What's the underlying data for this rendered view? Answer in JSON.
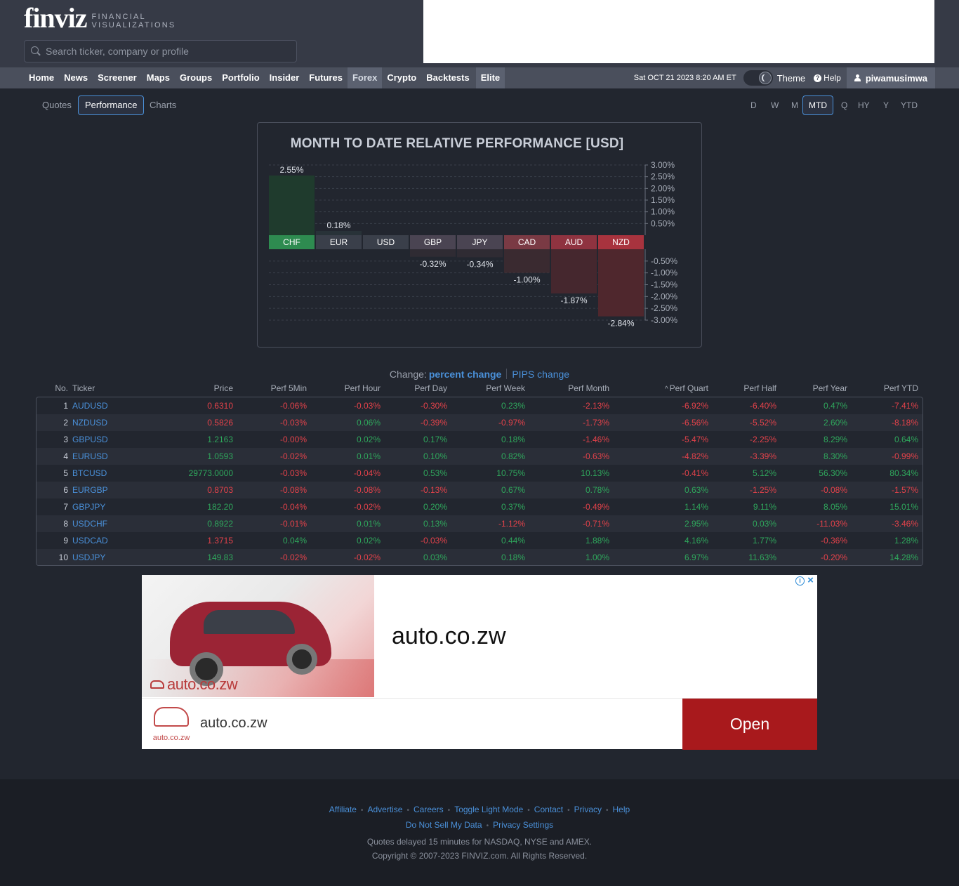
{
  "header": {
    "logo_word": "finviz",
    "logo_tag_line1": "FINANCIAL",
    "logo_tag_line2": "VISUALIZATIONS",
    "search_placeholder": "Search ticker, company or profile"
  },
  "nav": {
    "items": [
      {
        "label": "Home"
      },
      {
        "label": "News"
      },
      {
        "label": "Screener"
      },
      {
        "label": "Maps"
      },
      {
        "label": "Groups"
      },
      {
        "label": "Portfolio"
      },
      {
        "label": "Insider"
      },
      {
        "label": "Futures"
      },
      {
        "label": "Forex"
      },
      {
        "label": "Crypto"
      },
      {
        "label": "Backtests"
      },
      {
        "label": "Elite"
      }
    ],
    "active": "Forex",
    "datetime": "Sat OCT 21 2023 8:20 AM ET",
    "theme_label": "Theme",
    "help_label": "Help",
    "username": "piwamusimwa"
  },
  "view_tabs": [
    {
      "label": "Quotes"
    },
    {
      "label": "Performance"
    },
    {
      "label": "Charts"
    }
  ],
  "active_view": "Performance",
  "periods": [
    {
      "label": "D"
    },
    {
      "label": "W"
    },
    {
      "label": "M"
    },
    {
      "label": "MTD"
    },
    {
      "label": "Q"
    },
    {
      "label": "HY"
    },
    {
      "label": "Y"
    },
    {
      "label": "YTD"
    }
  ],
  "active_period": "MTD",
  "chart_data": {
    "type": "bar",
    "title": "MONTH TO DATE RELATIVE PERFORMANCE  [USD]",
    "categories": [
      "CHF",
      "EUR",
      "USD",
      "GBP",
      "JPY",
      "CAD",
      "AUD",
      "NZD"
    ],
    "values": [
      2.55,
      0.18,
      0.0,
      -0.32,
      -0.34,
      -1.0,
      -1.87,
      -2.84
    ],
    "value_labels": [
      "2.55%",
      "0.18%",
      "",
      "-0.32%",
      "-0.34%",
      "-1.00%",
      "-1.87%",
      "-2.84%"
    ],
    "yticks_pos": [
      "3.00%",
      "2.50%",
      "2.00%",
      "1.50%",
      "1.00%",
      "0.50%"
    ],
    "yticks_neg": [
      "-0.50%",
      "-1.00%",
      "-1.50%",
      "-2.00%",
      "-2.50%",
      "-3.00%"
    ],
    "ylim": [
      -3.0,
      3.0
    ],
    "label_colors": [
      "#2e8b50",
      "#3a3f4a",
      "#3a3f4a",
      "#4a4452",
      "#4a4452",
      "#7a3a44",
      "#8f3340",
      "#a8333e"
    ],
    "bar_colors": [
      "#1f3b2d",
      "#283238",
      "#262a33",
      "#2f2b33",
      "#2f2b33",
      "#3a2a30",
      "#45272e",
      "#4f272d"
    ],
    "grid": true
  },
  "change_selector": {
    "label": "Change:",
    "active": "percent change",
    "other": "PIPS change"
  },
  "table": {
    "columns": [
      "No.",
      "Ticker",
      "Price",
      "Perf 5Min",
      "Perf Hour",
      "Perf Day",
      "Perf Week",
      "Perf Month",
      "Perf Quart",
      "Perf Half",
      "Perf Year",
      "Perf YTD"
    ],
    "sort_column": "Perf Quart",
    "rows": [
      {
        "no": "1",
        "ticker": "AUDUSD",
        "price": "0.6310",
        "p5": "-0.06%",
        "ph": "-0.03%",
        "pd": "-0.30%",
        "pw": "0.23%",
        "pm": "-2.13%",
        "pq": "-6.92%",
        "phy": "-6.40%",
        "py": "0.47%",
        "pytd": "-7.41%"
      },
      {
        "no": "2",
        "ticker": "NZDUSD",
        "price": "0.5826",
        "p5": "-0.03%",
        "ph": "0.06%",
        "pd": "-0.39%",
        "pw": "-0.97%",
        "pm": "-1.73%",
        "pq": "-6.56%",
        "phy": "-5.52%",
        "py": "2.60%",
        "pytd": "-8.18%"
      },
      {
        "no": "3",
        "ticker": "GBPUSD",
        "price": "1.2163",
        "p5": "-0.00%",
        "ph": "0.02%",
        "pd": "0.17%",
        "pw": "0.18%",
        "pm": "-1.46%",
        "pq": "-5.47%",
        "phy": "-2.25%",
        "py": "8.29%",
        "pytd": "0.64%"
      },
      {
        "no": "4",
        "ticker": "EURUSD",
        "price": "1.0593",
        "p5": "-0.02%",
        "ph": "0.01%",
        "pd": "0.10%",
        "pw": "0.82%",
        "pm": "-0.63%",
        "pq": "-4.82%",
        "phy": "-3.39%",
        "py": "8.30%",
        "pytd": "-0.99%"
      },
      {
        "no": "5",
        "ticker": "BTCUSD",
        "price": "29773.0000",
        "p5": "-0.03%",
        "ph": "-0.04%",
        "pd": "0.53%",
        "pw": "10.75%",
        "pm": "10.13%",
        "pq": "-0.41%",
        "phy": "5.12%",
        "py": "56.30%",
        "pytd": "80.34%"
      },
      {
        "no": "6",
        "ticker": "EURGBP",
        "price": "0.8703",
        "p5": "-0.08%",
        "ph": "-0.08%",
        "pd": "-0.13%",
        "pw": "0.67%",
        "pm": "0.78%",
        "pq": "0.63%",
        "phy": "-1.25%",
        "py": "-0.08%",
        "pytd": "-1.57%"
      },
      {
        "no": "7",
        "ticker": "GBPJPY",
        "price": "182.20",
        "p5": "-0.04%",
        "ph": "-0.02%",
        "pd": "0.20%",
        "pw": "0.37%",
        "pm": "-0.49%",
        "pq": "1.14%",
        "phy": "9.11%",
        "py": "8.05%",
        "pytd": "15.01%"
      },
      {
        "no": "8",
        "ticker": "USDCHF",
        "price": "0.8922",
        "p5": "-0.01%",
        "ph": "0.01%",
        "pd": "0.13%",
        "pw": "-1.12%",
        "pm": "-0.71%",
        "pq": "2.95%",
        "phy": "0.03%",
        "py": "-11.03%",
        "pytd": "-3.46%"
      },
      {
        "no": "9",
        "ticker": "USDCAD",
        "price": "1.3715",
        "p5": "0.04%",
        "ph": "0.02%",
        "pd": "-0.03%",
        "pw": "0.44%",
        "pm": "1.88%",
        "pq": "4.16%",
        "phy": "1.77%",
        "py": "-0.36%",
        "pytd": "1.28%"
      },
      {
        "no": "10",
        "ticker": "USDJPY",
        "price": "149.83",
        "p5": "-0.02%",
        "ph": "-0.02%",
        "pd": "0.03%",
        "pw": "0.18%",
        "pm": "1.00%",
        "pq": "6.97%",
        "phy": "11.63%",
        "py": "-0.20%",
        "pytd": "14.28%"
      }
    ],
    "price_trend": [
      "neg",
      "neg",
      "pos",
      "pos",
      "pos",
      "neg",
      "pos",
      "pos",
      "neg",
      "pos"
    ]
  },
  "ad": {
    "headline": "auto.co.zw",
    "image_brand": "auto.co.zw",
    "logo_text": "auto.co.zw",
    "domain": "auto.co.zw",
    "cta": "Open"
  },
  "footer": {
    "links_row1": [
      "Affiliate",
      "Advertise",
      "Careers",
      "Toggle Light Mode",
      "Contact",
      "Privacy",
      "Help"
    ],
    "links_row2": [
      "Do Not Sell My Data",
      "Privacy Settings"
    ],
    "note1": "Quotes delayed 15 minutes for NASDAQ, NYSE and AMEX.",
    "note2": "Copyright © 2007-2023 FINVIZ.com. All Rights Reserved."
  },
  "colors": {
    "positive": "#2fa75c",
    "negative": "#e3424a",
    "link": "#4a90d9",
    "background": "#22262f"
  }
}
